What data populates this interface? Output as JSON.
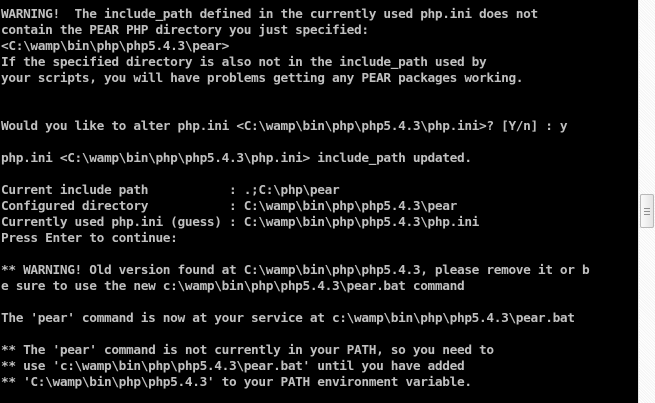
{
  "console": {
    "lines": [
      "WARNING!  The include_path defined in the currently used php.ini does not",
      "contain the PEAR PHP directory you just specified:",
      "<C:\\wamp\\bin\\php\\php5.4.3\\pear>",
      "If the specified directory is also not in the include_path used by",
      "your scripts, you will have problems getting any PEAR packages working.",
      "",
      "",
      "Would you like to alter php.ini <C:\\wamp\\bin\\php\\php5.4.3\\php.ini>? [Y/n] : y",
      "",
      "php.ini <C:\\wamp\\bin\\php\\php5.4.3\\php.ini> include_path updated.",
      "",
      "Current include path           : .;C:\\php\\pear",
      "Configured directory           : C:\\wamp\\bin\\php\\php5.4.3\\pear",
      "Currently used php.ini (guess) : C:\\wamp\\bin\\php\\php5.4.3\\php.ini",
      "Press Enter to continue:",
      "",
      "** WARNING! Old version found at C:\\wamp\\bin\\php\\php5.4.3, please remove it or b",
      "e sure to use the new c:\\wamp\\bin\\php\\php5.4.3\\pear.bat command",
      "",
      "The 'pear' command is now at your service at c:\\wamp\\bin\\php\\php5.4.3\\pear.bat",
      "",
      "** The 'pear' command is not currently in your PATH, so you need to",
      "** use 'c:\\wamp\\bin\\php\\php5.4.3\\pear.bat' until you have added",
      "** 'C:\\wamp\\bin\\php\\php5.4.3' to your PATH environment variable."
    ]
  },
  "colors": {
    "background": "#000000",
    "text": "#c0c0c0"
  }
}
